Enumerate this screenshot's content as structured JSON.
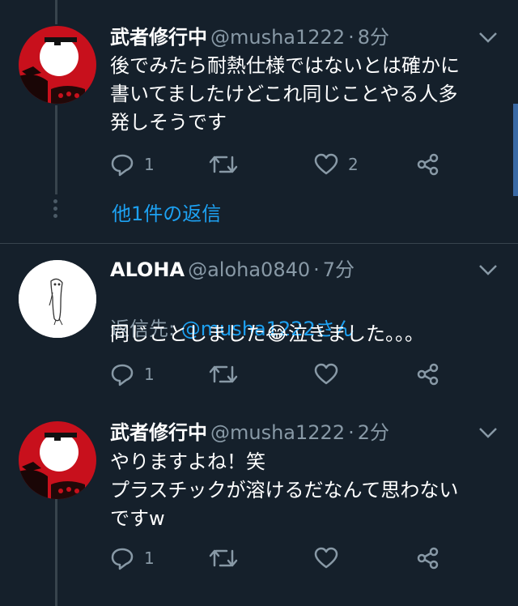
{
  "tweets": [
    {
      "name": "武者修行中",
      "handle": "@musha1222",
      "dot": "·",
      "time": "8分",
      "text": "後でみたら耐熱仕様ではないとは確かに\n書いてましたけどこれ同じことやる人多\n発しそうです",
      "reply_count": "1",
      "like_count": "2",
      "more_replies": "他1件の返信"
    },
    {
      "name": "ALOHA",
      "handle": "@aloha0840",
      "dot": "·",
      "time": "7分",
      "reply_to_label": "返信先: ",
      "reply_to_handle": "@musha1222さん",
      "text": "同じことしました😂泣きました。。。",
      "reply_count": "1"
    },
    {
      "name": "武者修行中",
      "handle": "@musha1222",
      "dot": "·",
      "time": "2分",
      "text": "やりますよね！笑\nプラスチックが溶けるだなんて思わない\nですw",
      "reply_count": "1"
    }
  ],
  "icons": {
    "reply": "reply-icon",
    "retweet": "retweet-icon",
    "like": "heart-icon",
    "share": "share-icon",
    "menu": "chevron-down-icon"
  },
  "colors": {
    "background": "#15202b",
    "secondary_text": "#8899a6",
    "link": "#1da1f2",
    "divider": "#38444d"
  }
}
